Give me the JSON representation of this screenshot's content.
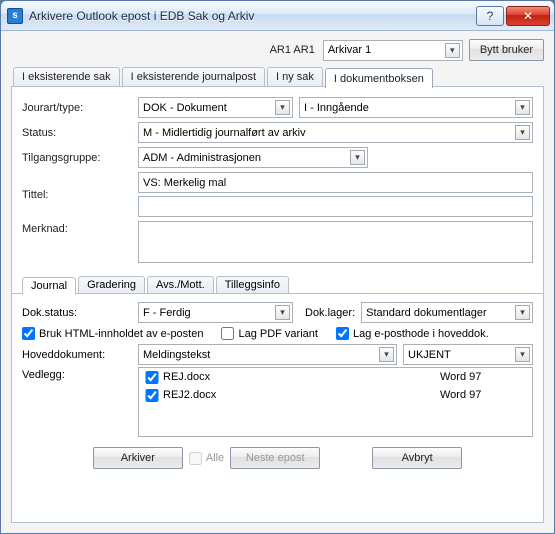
{
  "window": {
    "title": "Arkivere Outlook epost i EDB Sak og Arkiv",
    "help_icon": "?",
    "close_icon": "✕"
  },
  "header": {
    "user_display": "AR1 AR1",
    "role_combo": "Arkivar 1",
    "switch_user": "Bytt bruker"
  },
  "tabs": {
    "existing_case": "I eksisterende sak",
    "existing_journal": "I eksisterende journalpost",
    "new_case": "I ny sak",
    "document_box": "I dokumentboksen"
  },
  "form": {
    "labels": {
      "journal_type": "Jourart/type:",
      "status": "Status:",
      "access_group": "Tilgangsgruppe:",
      "title": "Tittel:",
      "note": "Merknad:"
    },
    "journal_type_primary": "DOK - Dokument",
    "journal_type_secondary": "I - Inngående",
    "status": "M - Midlertidig journalført av arkiv",
    "access_group": "ADM - Administrasjonen",
    "title": "VS: Merkelig mal",
    "note": ""
  },
  "mini_tabs": {
    "journal": "Journal",
    "grading": "Gradering",
    "avs_mott": "Avs./Mott.",
    "extra": "Tilleggsinfo"
  },
  "doc": {
    "labels": {
      "status": "Dok.status:",
      "store": "Dok.lager:",
      "main_doc": "Hoveddokument:",
      "attachments": "Vedlegg:"
    },
    "status": "F - Ferdig",
    "store": "Standard dokumentlager",
    "main_doc": "Meldingstekst",
    "main_doc_type": "UKJENT"
  },
  "checks": {
    "use_html": "Bruk HTML-innholdet av e-posten",
    "pdf_variant": "Lag PDF variant",
    "header_main": "Lag e-posthode i hoveddok."
  },
  "attachments": [
    {
      "name": "REJ.docx",
      "format": "Word 97",
      "checked": true
    },
    {
      "name": "REJ2.docx",
      "format": "Word 97",
      "checked": true
    }
  ],
  "footer": {
    "archive": "Arkiver",
    "all": "Alle",
    "next": "Neste epost",
    "cancel": "Avbryt"
  }
}
